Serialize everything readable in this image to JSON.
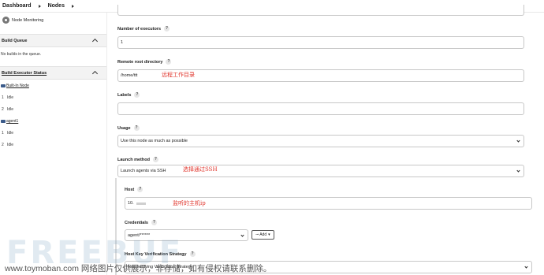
{
  "breadcrumb": {
    "items": [
      "Dashboard",
      "Nodes"
    ]
  },
  "sidebar": {
    "node_monitoring": "Node Monitoring",
    "build_queue": {
      "title": "Build Queue",
      "empty_text": "No builds in the queue."
    },
    "executor_status": {
      "title": "Build Executor Status",
      "computers": [
        {
          "name": "Built-In Node",
          "executors": [
            {
              "num": "1",
              "state": "Idle"
            },
            {
              "num": "2",
              "state": "Idle"
            }
          ]
        },
        {
          "name": "agent1",
          "executors": [
            {
              "num": "1",
              "state": "Idle"
            },
            {
              "num": "2",
              "state": "Idle"
            }
          ]
        }
      ]
    }
  },
  "form": {
    "help_glyph": "?",
    "executors": {
      "label": "Number of executors",
      "value": "1"
    },
    "remote_root": {
      "label": "Remote root directory",
      "value": "/home/ttt",
      "annotation": "远程工作目录"
    },
    "labels": {
      "label": "Labels",
      "value": ""
    },
    "usage": {
      "label": "Usage",
      "value": "Use this node as much as possible"
    },
    "launch": {
      "label": "Launch method",
      "value": "Launch agents via SSH",
      "annotation": "选择通过SSH"
    },
    "host": {
      "label": "Host",
      "value": "10.",
      "annotation": "监听的主机ip"
    },
    "credentials": {
      "label": "Credentials",
      "value": "agent/******",
      "add_label": "Add"
    },
    "host_key": {
      "label": "Host Key Verification Strategy",
      "value": "Non verifying Verification Strategy"
    }
  },
  "watermark": {
    "logo": "FREEBUF",
    "text": "www.toymoban.com 网络图片仅供展示，非存储，如有侵权请联系删除。"
  }
}
